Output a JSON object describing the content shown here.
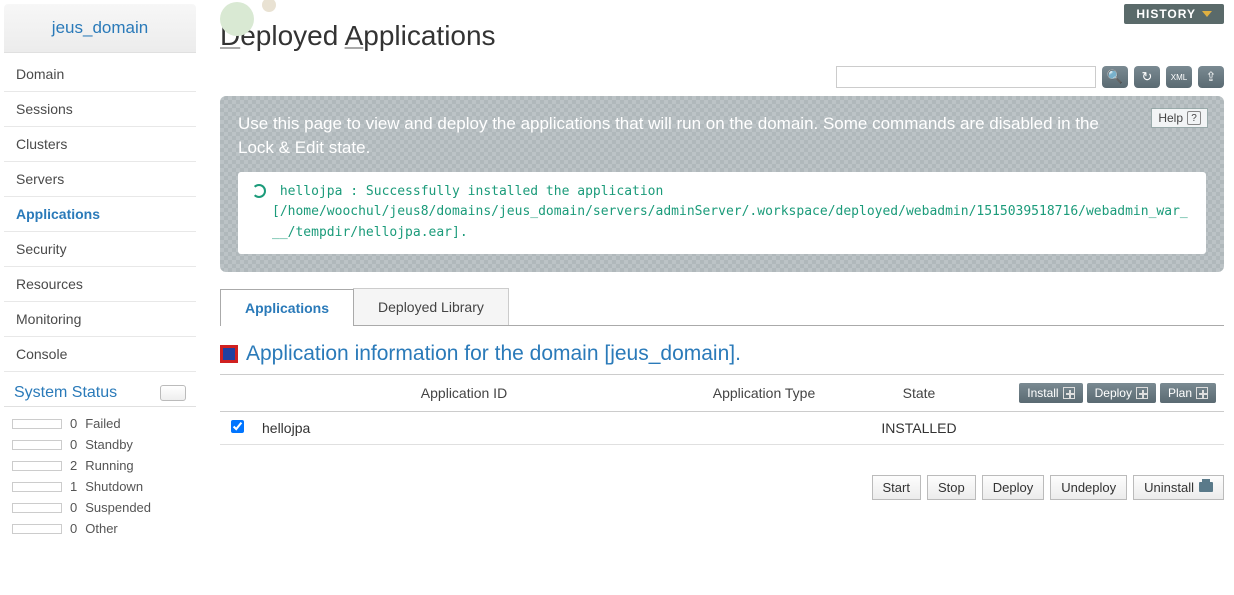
{
  "sidebar": {
    "domain_title": "jeus_domain",
    "items": [
      {
        "label": "Domain"
      },
      {
        "label": "Sessions"
      },
      {
        "label": "Clusters"
      },
      {
        "label": "Servers"
      },
      {
        "label": "Applications",
        "active": true
      },
      {
        "label": "Security"
      },
      {
        "label": "Resources"
      },
      {
        "label": "Monitoring"
      },
      {
        "label": "Console"
      }
    ],
    "status": {
      "title": "System Status",
      "rows": [
        {
          "count": "0",
          "label": "Failed",
          "fill": ""
        },
        {
          "count": "0",
          "label": "Standby",
          "fill": ""
        },
        {
          "count": "2",
          "label": "Running",
          "fill": "green"
        },
        {
          "count": "1",
          "label": "Shutdown",
          "fill": "red"
        },
        {
          "count": "0",
          "label": "Suspended",
          "fill": ""
        },
        {
          "count": "0",
          "label": "Other",
          "fill": ""
        }
      ]
    }
  },
  "header": {
    "history": "HISTORY",
    "page_title": "Deployed Applications",
    "search_placeholder": ""
  },
  "info": {
    "help": "Help",
    "text": "Use this page to view and deploy the applications that will run on the domain. Some commands are disabled in the Lock & Edit state.",
    "msg_label": "hellojpa : Successfully installed the application",
    "msg_path": "[/home/woochul/jeus8/domains/jeus_domain/servers/adminServer/.workspace/deployed/webadmin/1515039518716/webadmin_war___/tempdir/hellojpa.ear]."
  },
  "tabs": [
    {
      "label": "Applications",
      "active": true
    },
    {
      "label": "Deployed Library"
    }
  ],
  "section_title": "Application information for the domain [jeus_domain].",
  "table": {
    "headers": {
      "id": "Application ID",
      "type": "Application Type",
      "state": "State"
    },
    "header_buttons": {
      "install": "Install",
      "deploy": "Deploy",
      "plan": "Plan"
    },
    "rows": [
      {
        "checked": true,
        "id": "hellojpa",
        "type": "",
        "state": "INSTALLED"
      }
    ]
  },
  "actions": {
    "start": "Start",
    "stop": "Stop",
    "deploy": "Deploy",
    "undeploy": "Undeploy",
    "uninstall": "Uninstall"
  }
}
